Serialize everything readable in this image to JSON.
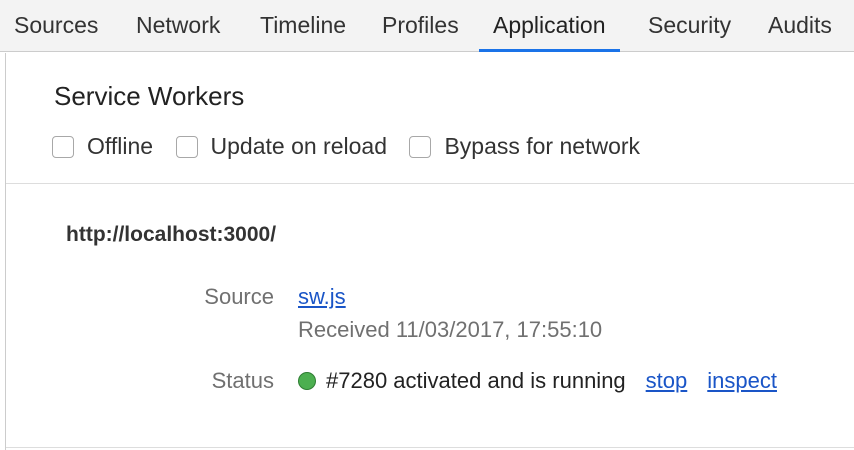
{
  "tabs": [
    {
      "label": "Sources",
      "active": false
    },
    {
      "label": "Network",
      "active": false
    },
    {
      "label": "Timeline",
      "active": false
    },
    {
      "label": "Profiles",
      "active": false
    },
    {
      "label": "Application",
      "active": true
    },
    {
      "label": "Security",
      "active": false
    },
    {
      "label": "Audits",
      "active": false
    }
  ],
  "section": {
    "title": "Service Workers",
    "options": [
      {
        "label": "Offline",
        "checked": false
      },
      {
        "label": "Update on reload",
        "checked": false
      },
      {
        "label": "Bypass for network",
        "checked": false
      }
    ]
  },
  "worker": {
    "scope": "http://localhost:3000/",
    "source_label": "Source",
    "source_file": "sw.js",
    "received": "Received 11/03/2017, 17:55:10",
    "status_label": "Status",
    "status_color": "#4caf50",
    "status_text": "#7280 activated and is running",
    "stop_label": "stop",
    "inspect_label": "inspect"
  },
  "colors": {
    "accent": "#1a73e8",
    "link": "#1a55c7"
  }
}
